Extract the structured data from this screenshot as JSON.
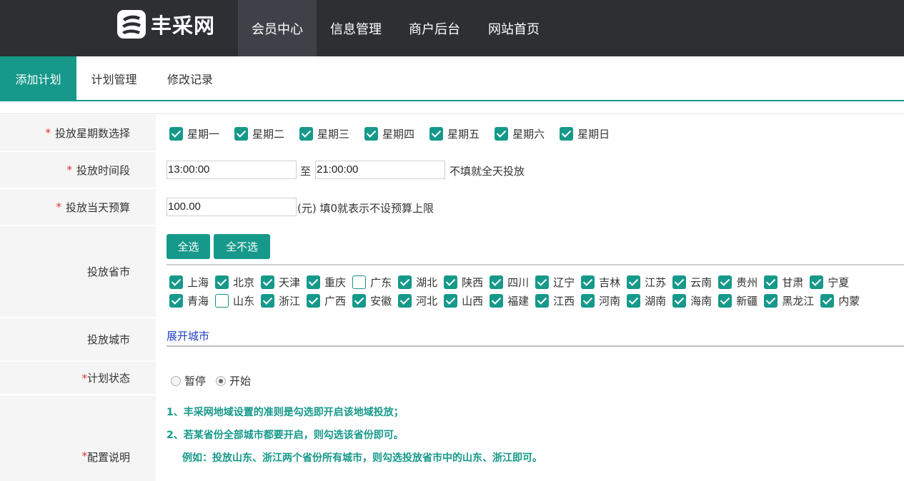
{
  "logo": {
    "text": "丰采网"
  },
  "nav": [
    "会员中心",
    "信息管理",
    "商户后台",
    "网站首页"
  ],
  "tabs": [
    "添加计划",
    "计划管理",
    "修改记录"
  ],
  "form": {
    "weekdays": {
      "label": "投放星期数选择",
      "required": "*",
      "options": [
        {
          "label": "星期一",
          "checked": true
        },
        {
          "label": "星期二",
          "checked": true
        },
        {
          "label": "星期三",
          "checked": true
        },
        {
          "label": "星期四",
          "checked": true
        },
        {
          "label": "星期五",
          "checked": true
        },
        {
          "label": "星期六",
          "checked": true
        },
        {
          "label": "星期日",
          "checked": true
        }
      ]
    },
    "time": {
      "label": "投放时间段",
      "required": "*",
      "start": "13:00:00",
      "to": "至",
      "end": "21:00:00",
      "hint": "不填就全天投放"
    },
    "budget": {
      "label": "投放当天预算",
      "required": "*",
      "value": "100.00",
      "hint": "(元) 填0就表示不设预算上限"
    },
    "provinces": {
      "label": "投放省市",
      "select_all": "全选",
      "select_none": "全不选",
      "row1": [
        {
          "label": "上海",
          "checked": true
        },
        {
          "label": "北京",
          "checked": true
        },
        {
          "label": "天津",
          "checked": true
        },
        {
          "label": "重庆",
          "checked": true
        },
        {
          "label": "广东",
          "checked": false
        },
        {
          "label": "湖北",
          "checked": true
        },
        {
          "label": "陕西",
          "checked": true
        },
        {
          "label": "四川",
          "checked": true
        },
        {
          "label": "辽宁",
          "checked": true
        },
        {
          "label": "吉林",
          "checked": true
        },
        {
          "label": "江苏",
          "checked": true
        },
        {
          "label": "云南",
          "checked": true
        },
        {
          "label": "贵州",
          "checked": true
        },
        {
          "label": "甘肃",
          "checked": true
        },
        {
          "label": "宁夏",
          "checked": true
        }
      ],
      "row2": [
        {
          "label": "青海",
          "checked": true
        },
        {
          "label": "山东",
          "checked": false
        },
        {
          "label": "浙江",
          "checked": true
        },
        {
          "label": "广西",
          "checked": true
        },
        {
          "label": "安徽",
          "checked": true
        },
        {
          "label": "河北",
          "checked": true
        },
        {
          "label": "山西",
          "checked": true
        },
        {
          "label": "福建",
          "checked": true
        },
        {
          "label": "江西",
          "checked": true
        },
        {
          "label": "河南",
          "checked": true
        },
        {
          "label": "湖南",
          "checked": true
        },
        {
          "label": "海南",
          "checked": true
        },
        {
          "label": "新疆",
          "checked": true
        },
        {
          "label": "黑龙江",
          "checked": true
        },
        {
          "label": "内蒙",
          "checked": true
        }
      ]
    },
    "cities": {
      "label": "投放城市",
      "expand": "展开城市"
    },
    "status": {
      "label": "计划状态",
      "required": "*",
      "options": [
        {
          "label": "暂停",
          "selected": false
        },
        {
          "label": "开始",
          "selected": true
        }
      ]
    },
    "notes": {
      "label": "配置说明",
      "required": "*",
      "lines": [
        "1、丰采网地域设置的准则是勾选即开启该地域投放；",
        "2、若某省份全部城市都要开启，则勾选该省份即可。",
        "例如：投放山东、浙江两个省份所有城市，则勾选投放省市中的山东、浙江即可。"
      ]
    }
  }
}
